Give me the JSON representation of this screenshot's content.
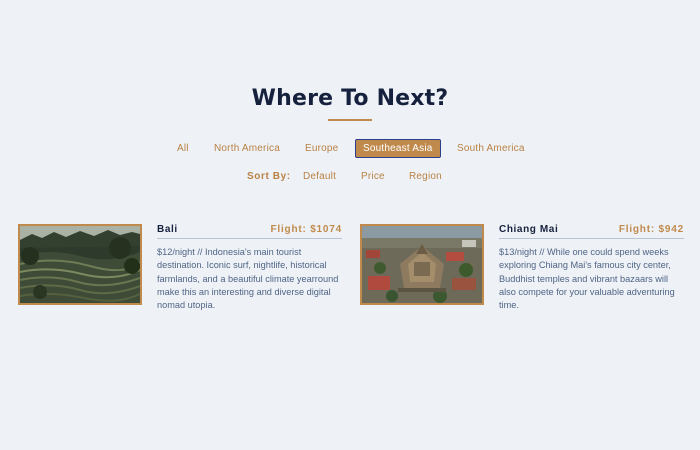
{
  "header": {
    "title": "Where To Next?"
  },
  "filters": [
    {
      "label": "All",
      "active": false
    },
    {
      "label": "North America",
      "active": false
    },
    {
      "label": "Europe",
      "active": false
    },
    {
      "label": "Southeast Asia",
      "active": true
    },
    {
      "label": "South America",
      "active": false
    }
  ],
  "sort": {
    "label": "Sort By:",
    "options": [
      "Default",
      "Price",
      "Region"
    ]
  },
  "destinations": [
    {
      "name": "Bali",
      "flight": "Flight: $1074",
      "description": "$12/night // Indonesia's main tourist destination. Iconic surf, nightlife, historical farmlands, and a beautiful climate yearround make this an interesting and diverse digital nomad utopia.",
      "image_icon": "rice-terrace-photo"
    },
    {
      "name": "Chiang Mai",
      "flight": "Flight: $942",
      "description": "$13/night // While one could spend weeks exploring Chiang Mai's famous city center, Buddhist temples and vibrant bazaars will also compete for your valuable adventuring time.",
      "image_icon": "temple-aerial-photo"
    }
  ],
  "colors": {
    "accent": "#c08a4d",
    "background": "#eef2f6",
    "title": "#16213e",
    "body_text": "#4f6486"
  }
}
